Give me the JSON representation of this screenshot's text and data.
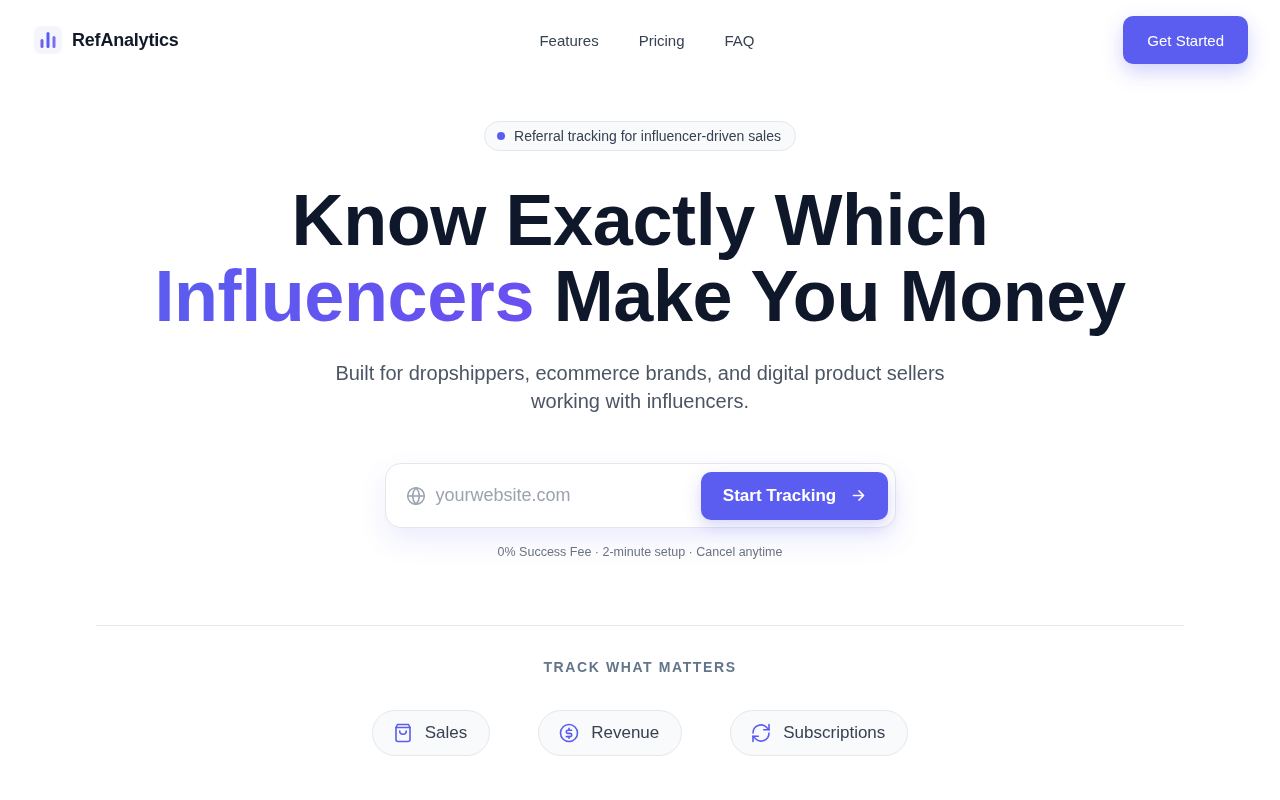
{
  "nav": {
    "logo": "RefAnalytics",
    "links": [
      "Features",
      "Pricing",
      "FAQ"
    ],
    "cta": "Get Started"
  },
  "hero": {
    "badge": "Referral tracking for influencer-driven sales",
    "headline": {
      "line_1": "Know Exactly Which",
      "highlight": "Influencers",
      "line_2_rest": "Make You Money"
    },
    "subtitle": "Built for dropshippers, ecommerce brands, and digital product sellers working with influencers."
  },
  "signup": {
    "placeholder": "yourwebsite.com",
    "button": "Start Tracking",
    "note": "0% Success Fee · 2-minute setup · Cancel anytime"
  },
  "metrics": {
    "heading": "TRACK WHAT MATTERS",
    "items": [
      {
        "label": "Sales",
        "kind": "bag"
      },
      {
        "label": "Revenue",
        "kind": "dollar"
      },
      {
        "label": "Subscriptions",
        "kind": "refresh"
      }
    ]
  }
}
